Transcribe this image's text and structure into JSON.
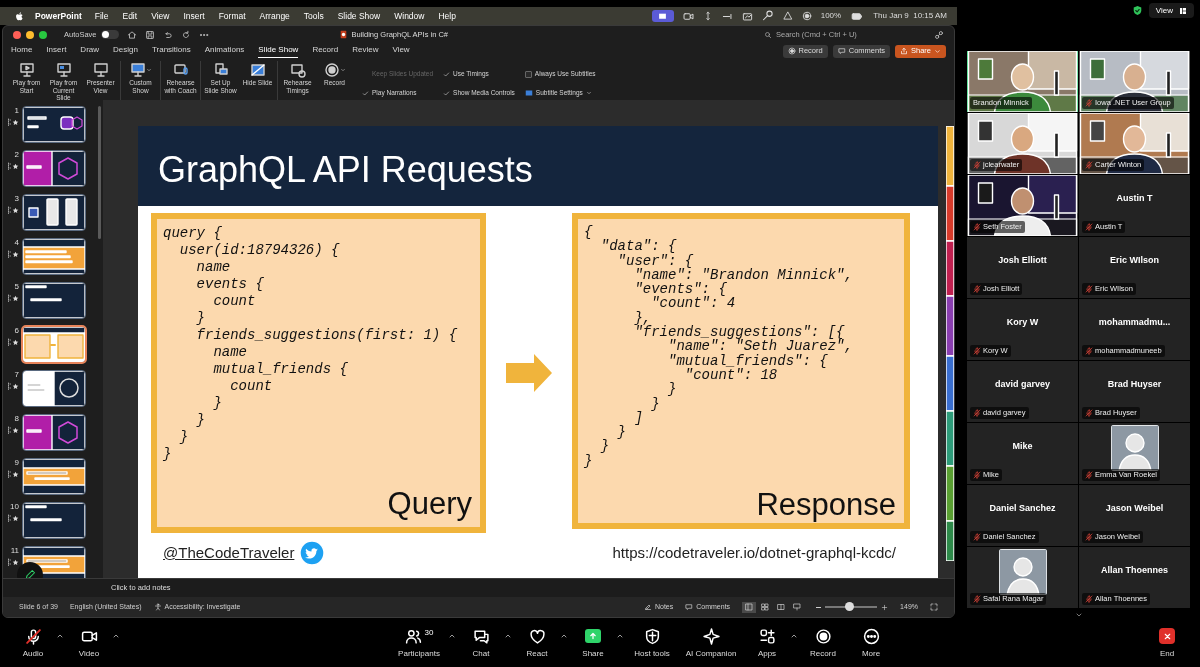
{
  "menu_bar": {
    "app": "PowerPoint",
    "items": [
      "File",
      "Edit",
      "View",
      "Insert",
      "Format",
      "Arrange",
      "Tools",
      "Slide Show",
      "Window",
      "Help"
    ],
    "battery": "100%",
    "clock": "Thu Jan 9  10:15 AM"
  },
  "title_bar": {
    "autosave": "AutoSave",
    "autosave_on": false,
    "document": "Building GraphQL APIs in C#",
    "search_placeholder": "Search (Cmd + Ctrl + U)"
  },
  "tabs": [
    {
      "label": "Home",
      "selected": false
    },
    {
      "label": "Insert",
      "selected": false
    },
    {
      "label": "Draw",
      "selected": false
    },
    {
      "label": "Design",
      "selected": false
    },
    {
      "label": "Transitions",
      "selected": false
    },
    {
      "label": "Animations",
      "selected": false
    },
    {
      "label": "Slide Show",
      "selected": true
    },
    {
      "label": "Record",
      "selected": false
    },
    {
      "label": "Review",
      "selected": false
    },
    {
      "label": "View",
      "selected": false
    }
  ],
  "actions": [
    {
      "label": "Record",
      "kind": "record"
    },
    {
      "label": "Comments",
      "kind": "comments"
    },
    {
      "label": "Share",
      "kind": "share"
    }
  ],
  "ribbon_groups": [
    [
      {
        "label": "Play from Start",
        "kind": "play-start",
        "dropdown": false
      },
      {
        "label": "Play from Current Slide",
        "kind": "play-current",
        "dropdown": false
      },
      {
        "label": "Presenter View",
        "kind": "presenter",
        "dropdown": false
      }
    ],
    [
      {
        "label": "Custom Show",
        "kind": "custom",
        "dropdown": true
      }
    ],
    [
      {
        "label": "Rehearse with Coach",
        "kind": "coach",
        "dropdown": false
      }
    ],
    [
      {
        "label": "Set Up Slide Show",
        "kind": "setup",
        "dropdown": false
      },
      {
        "label": "Hide Slide",
        "kind": "hide",
        "dropdown": false
      }
    ],
    [
      {
        "label": "Rehearse Timings",
        "kind": "timings",
        "dropdown": false
      },
      {
        "label": "Record",
        "kind": "record",
        "dropdown": true
      }
    ]
  ],
  "ribbon_options": [
    {
      "label": "Keep Slides Updated",
      "kind": "check",
      "checked": false,
      "disabled": true
    },
    {
      "label": "Play Narrations",
      "kind": "check",
      "checked": true,
      "disabled": false
    },
    {
      "label": "Use Timings",
      "kind": "check",
      "checked": true,
      "disabled": false
    },
    {
      "label": "Show Media Controls",
      "kind": "check",
      "checked": true,
      "disabled": false
    },
    {
      "label": "Always Use Subtitles",
      "kind": "checkbox",
      "checked": false,
      "disabled": false
    },
    {
      "label": "Subtitle Settings",
      "kind": "dropdown",
      "disabled": false
    }
  ],
  "thumbnails": [
    {
      "number": "1",
      "kind": "title",
      "selected": false
    },
    {
      "number": "2",
      "kind": "purple",
      "selected": false
    },
    {
      "number": "3",
      "kind": "phones",
      "selected": false
    },
    {
      "number": "4",
      "kind": "orange-list",
      "selected": false
    },
    {
      "number": "5",
      "kind": "dark",
      "selected": false
    },
    {
      "number": "6",
      "kind": "code",
      "selected": true
    },
    {
      "number": "7",
      "kind": "white",
      "selected": false
    },
    {
      "number": "8",
      "kind": "purple",
      "selected": false
    },
    {
      "number": "9",
      "kind": "orange-band",
      "selected": false
    },
    {
      "number": "10",
      "kind": "dark",
      "selected": false
    },
    {
      "number": "11",
      "kind": "orange-band",
      "selected": false
    }
  ],
  "slide": {
    "title": "GraphQL API Requests",
    "query": "query {\n  user(id:18794326) {\n    name\n    events {\n      count\n    }\n    friends_suggestions(first: 1) {\n      name\n      mutual_friends {\n        count\n      }\n    }\n  }\n}",
    "query_label": "Query",
    "response": "{\n  \"data\": {\n    \"user\": {\n      \"name\": \"Brandon Minnick\",\n      \"events\": {\n        \"count\": 4\n      },\n      \"friends_suggestions\": [{\n          \"name\": \"Seth Juarez\",\n          \"mutual_friends\": {\n            \"count\": 18\n          }\n        }\n      ]\n    }\n  }\n}",
    "response_label": "Response",
    "handle": "@TheCodeTraveler",
    "url": "https://codetraveler.io/dotnet-graphql-kcdc/"
  },
  "notes_placeholder": "Click to add notes",
  "status_bar": {
    "slide": "Slide 6 of 39",
    "language": "English (United States)",
    "accessibility": "Accessibility: Investigate",
    "notes": "Notes",
    "comments": "Comments",
    "views": [
      {
        "kind": "normal",
        "selected": true
      },
      {
        "kind": "sorter",
        "selected": false
      },
      {
        "kind": "reading",
        "selected": false
      },
      {
        "kind": "show",
        "selected": false
      }
    ],
    "zoom_slider": {
      "level": 0.46
    },
    "zoom": "149%"
  },
  "gallery_view": "View",
  "participants": [
    {
      "label": "Brandon Minnick",
      "kind": "video",
      "muted": false,
      "speaking": true
    },
    {
      "label": "Iowa .NET User Group",
      "kind": "video",
      "muted": true,
      "speaking": false
    },
    {
      "label": "jclearwater",
      "kind": "video",
      "muted": true,
      "speaking": false
    },
    {
      "label": "Carter Winton",
      "kind": "video",
      "muted": true,
      "speaking": false
    },
    {
      "label": "Seth Foster",
      "kind": "video",
      "muted": true,
      "speaking": false
    },
    {
      "name": "Austin T",
      "label": "Austin T",
      "kind": "name",
      "muted": true,
      "speaking": false
    },
    {
      "name": "Josh Elliott",
      "label": "Josh Elliott",
      "kind": "name",
      "muted": true,
      "speaking": false
    },
    {
      "name": "Eric WIlson",
      "label": "Eric WIlson",
      "kind": "name",
      "muted": true,
      "speaking": false
    },
    {
      "name": "Kory W",
      "label": "Kory W",
      "kind": "name",
      "muted": true,
      "speaking": false
    },
    {
      "name": "mohammadmu...",
      "label": "mohammadmuneeb",
      "kind": "name",
      "muted": true,
      "speaking": false
    },
    {
      "name": "david garvey",
      "label": "david garvey",
      "kind": "name",
      "muted": true,
      "speaking": false
    },
    {
      "name": "Brad Huyser",
      "label": "Brad Huyser",
      "kind": "name",
      "muted": true,
      "speaking": false
    },
    {
      "name": "Mike",
      "label": "Mike",
      "kind": "name",
      "muted": true,
      "speaking": false
    },
    {
      "label": "Emma Van Roekel",
      "kind": "avatar",
      "muted": true,
      "speaking": false
    },
    {
      "name": "Daniel Sanchez",
      "label": "Daniel Sanchez",
      "kind": "name",
      "muted": true,
      "speaking": false
    },
    {
      "name": "Jason Weibel",
      "label": "Jason Weibel",
      "kind": "name",
      "muted": true,
      "speaking": false
    },
    {
      "label": "Safal Rana Magar",
      "kind": "avatar",
      "muted": true,
      "speaking": false
    },
    {
      "name": "Allan Thoennes",
      "label": "Allan Thoennes",
      "kind": "name",
      "muted": true,
      "speaking": false
    }
  ],
  "toolbar": [
    {
      "label": "Audio",
      "kind": "audio",
      "caret": true,
      "muted": true
    },
    {
      "label": "Video",
      "kind": "video",
      "caret": true
    },
    {
      "label": "Participants",
      "kind": "participants",
      "count": "30",
      "caret": true
    },
    {
      "label": "Chat",
      "kind": "chat",
      "caret": true
    },
    {
      "label": "React",
      "kind": "react",
      "caret": true
    },
    {
      "label": "Share",
      "kind": "share",
      "caret": true
    },
    {
      "label": "Host tools",
      "kind": "host",
      "caret": false
    },
    {
      "label": "AI Companion",
      "kind": "ai",
      "caret": false
    },
    {
      "label": "Apps",
      "kind": "apps",
      "caret": true
    },
    {
      "label": "Record",
      "kind": "record",
      "caret": false
    },
    {
      "label": "More",
      "kind": "more",
      "caret": false
    },
    {
      "label": "End",
      "kind": "end",
      "caret": false
    }
  ]
}
